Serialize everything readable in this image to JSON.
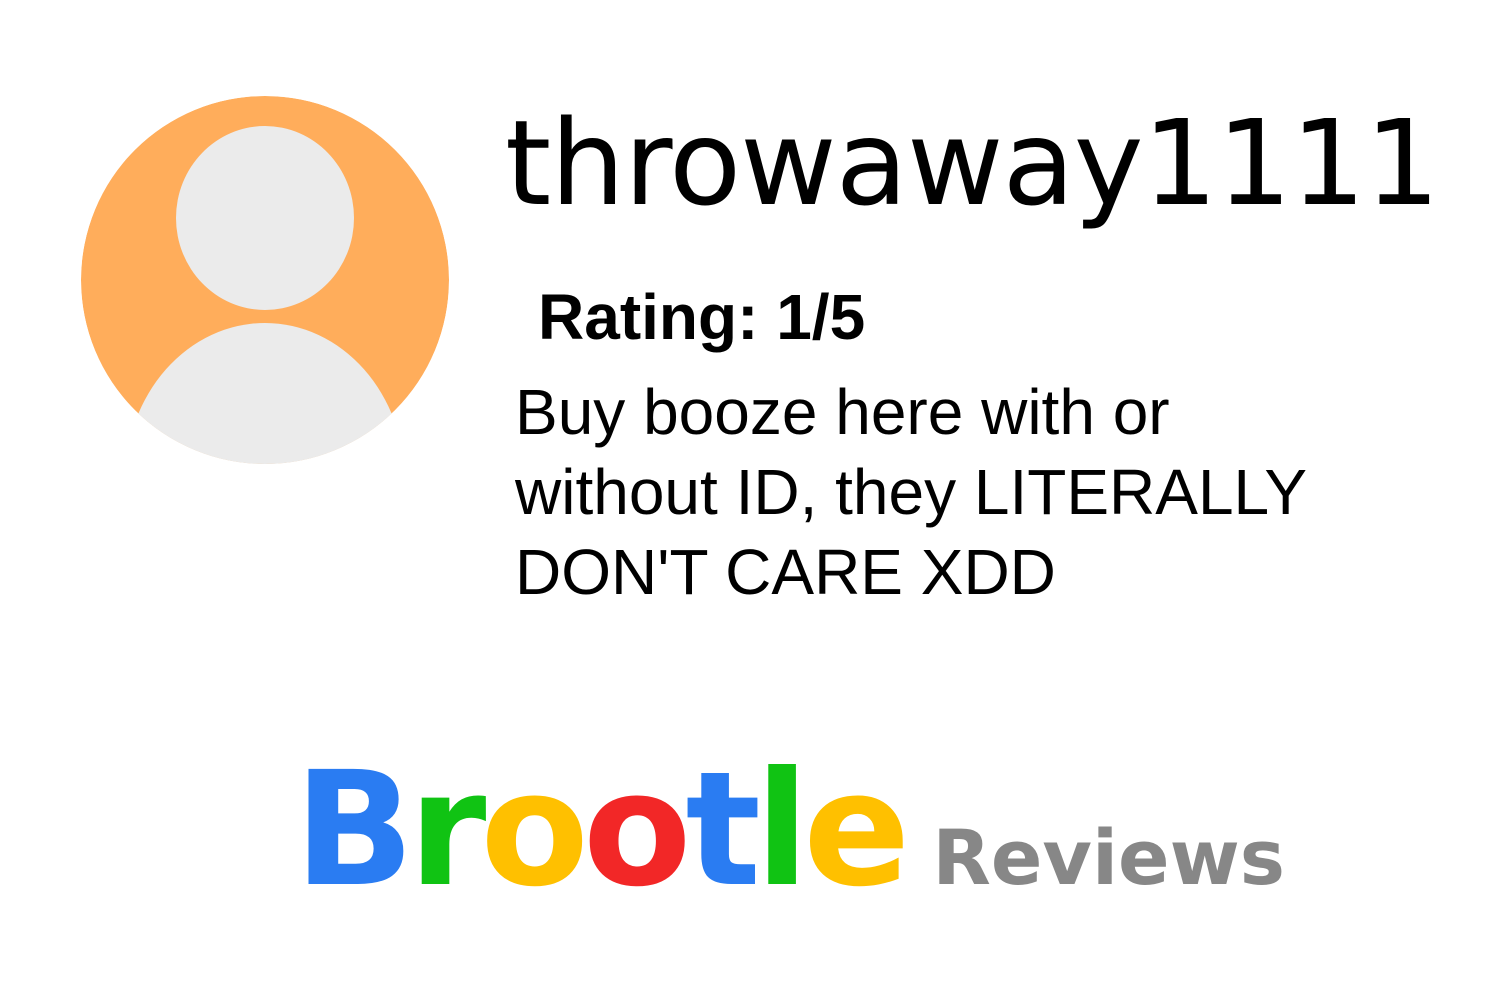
{
  "review": {
    "username": "throwaway1111",
    "rating_label": "Rating: 1/5",
    "text_lines": [
      "Buy booze here with or",
      "without ID, they LITERALLY",
      "DON'T CARE XDD"
    ],
    "rating_value": 1,
    "rating_max": 5
  },
  "avatar": {
    "icon": "default-user-avatar-icon",
    "background_color": "#FFAD5B",
    "silhouette_color": "#EBEBEB"
  },
  "brand": {
    "letters": [
      {
        "char": "B",
        "color": "#2A7CF2"
      },
      {
        "char": "r",
        "color": "#10C313"
      },
      {
        "char": "o",
        "color": "#FFC000"
      },
      {
        "char": "o",
        "color": "#F22727"
      },
      {
        "char": "t",
        "color": "#2A7CF2"
      },
      {
        "char": "l",
        "color": "#10C313"
      },
      {
        "char": "e",
        "color": "#FFC000"
      }
    ],
    "subtitle": "Reviews",
    "subtitle_color": "#878787"
  }
}
